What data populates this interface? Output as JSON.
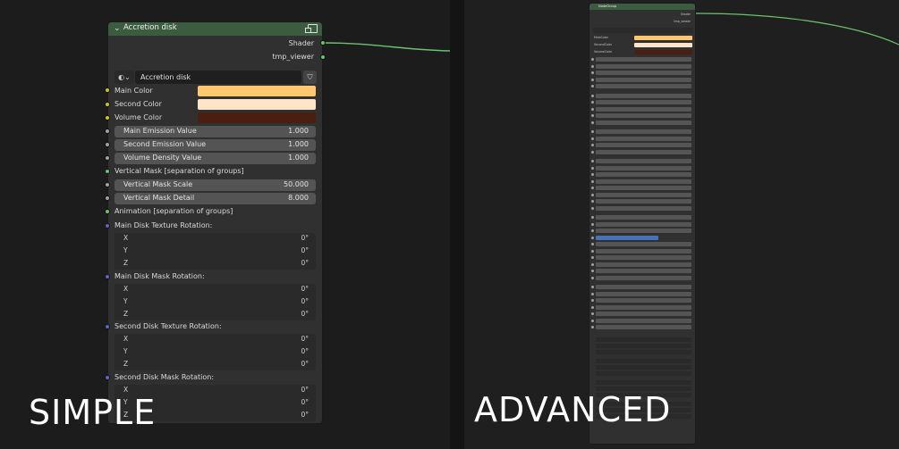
{
  "captions": {
    "left": "SIMPLE",
    "right": "ADVANCED"
  },
  "simple_node": {
    "title": "Accretion disk",
    "header_color": "#3c5c40",
    "outputs": [
      "Shader",
      "tmp_viewer"
    ],
    "selector": {
      "value": "Accretion disk"
    },
    "colors": [
      {
        "label": "Main Color",
        "swatch": "#ffc870"
      },
      {
        "label": "Second Color",
        "swatch": "#ffe4c8"
      },
      {
        "label": "Volume Color",
        "swatch": "#4a1e10"
      }
    ],
    "values": [
      {
        "label": "Main Emission Value",
        "value": "1.000"
      },
      {
        "label": "Second Emission Value",
        "value": "1.000"
      },
      {
        "label": "Volume Density Value",
        "value": "1.000"
      }
    ],
    "vertical_group": "Vertical Mask [separation of groups]",
    "vertical_values": [
      {
        "label": "Vertical Mask Scale",
        "value": "50.000"
      },
      {
        "label": "Vertical Mask Detail",
        "value": "8.000"
      }
    ],
    "animation_group": "Animation [separation of groups]",
    "rotations": [
      {
        "label": "Main Disk Texture Rotation:",
        "x": "0°",
        "y": "0°",
        "z": "0°"
      },
      {
        "label": "Main Disk Mask Rotation:",
        "x": "0°",
        "y": "0°",
        "z": "0°"
      },
      {
        "label": "Second Disk Texture Rotation:",
        "x": "0°",
        "y": "0°",
        "z": "0°"
      },
      {
        "label": "Second Disk Mask Rotation:",
        "x": "0°",
        "y": "0°",
        "z": "0°"
      }
    ],
    "axis": {
      "x": "X",
      "y": "Y",
      "z": "Z"
    }
  },
  "advanced_node": {
    "title": "NodeGroup",
    "outputs": [
      "Shader",
      "tmp_viewer"
    ],
    "colors": [
      {
        "label": "MainColor",
        "swatch": "#ffc870"
      },
      {
        "label": "SecondColor",
        "swatch": "#ffe4c8"
      },
      {
        "label": "VolumeColor",
        "swatch": "#4a1e10"
      }
    ]
  }
}
